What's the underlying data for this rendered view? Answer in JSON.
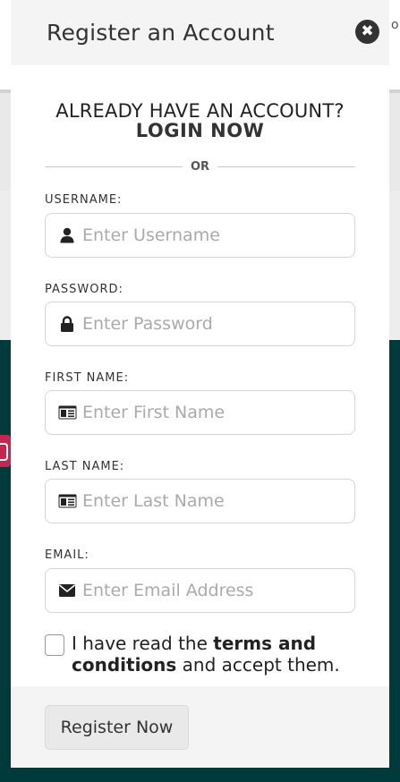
{
  "background": {
    "peek_text": "o"
  },
  "modal": {
    "title": "Register an Account",
    "close_symbol": "✖",
    "login_prompt": "ALREADY HAVE AN ACCOUNT?",
    "login_link": "LOGIN NOW",
    "divider_text": "OR"
  },
  "fields": {
    "username": {
      "label": "USERNAME:",
      "placeholder": "Enter Username",
      "value": "",
      "icon": "user-icon"
    },
    "password": {
      "label": "PASSWORD:",
      "placeholder": "Enter Password",
      "value": "",
      "icon": "lock-icon"
    },
    "first_name": {
      "label": "FIRST NAME:",
      "placeholder": "Enter First Name",
      "value": "",
      "icon": "id-card-icon"
    },
    "last_name": {
      "label": "LAST NAME:",
      "placeholder": "Enter Last Name",
      "value": "",
      "icon": "id-card-icon"
    },
    "email": {
      "label": "EMAIL:",
      "placeholder": "Enter Email Address",
      "value": "",
      "icon": "envelope-icon"
    }
  },
  "terms": {
    "prefix": "I have read the ",
    "link": "terms and conditions",
    "suffix": " and accept them.",
    "checked": false
  },
  "footer": {
    "register_label": "Register Now"
  },
  "colors": {
    "dark_background": "#003a3a",
    "instagram_accent": "#c5264f",
    "close_button": "#333333",
    "footer_background": "#f4f4f4"
  }
}
